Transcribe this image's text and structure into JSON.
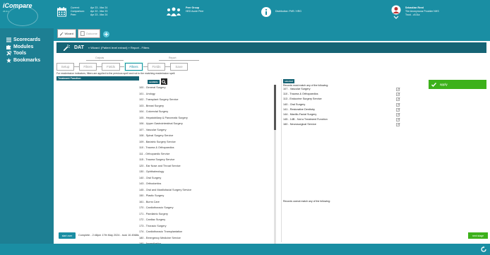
{
  "header": {
    "logo_text": "iCompare",
    "logo_version": "v5.0.1",
    "periods": [
      {
        "label": "Current:",
        "value": "Apr 23 - Mar 24"
      },
      {
        "label": "Comparison:",
        "value": "Apr 22 - Mar 23"
      },
      {
        "label": "Peer:",
        "value": "Apr 23 - Mar 24"
      }
    ],
    "peer_group": {
      "title": "Peer Group",
      "value": "HED Acute Peer"
    },
    "distribution": "Distribution: PbR / HRG",
    "user": {
      "name": "Sebastian Reed",
      "org": "The Anonymous Provider NHS",
      "trust": "Trust - z101a"
    }
  },
  "sidebar": {
    "items": [
      {
        "label": "Scorecards",
        "icon": "list-icon"
      },
      {
        "label": "Modules",
        "icon": "puzzle-icon"
      },
      {
        "label": "Tools",
        "icon": "tools-icon"
      },
      {
        "label": "Bookmarks",
        "icon": "star-icon"
      }
    ]
  },
  "toolbar": {
    "wizard_label": "Wizard",
    "outcome_label": "Outcome"
  },
  "title_bar": {
    "dat_label": "DAT",
    "breadcrumb": "»  Wizard: (Patient level extract)  »  Report - Filters"
  },
  "steps": {
    "groups": {
      "outputs": "Outputs",
      "report": "Report"
    },
    "items": [
      "Setup",
      "Filters",
      "Fields",
      "Filters",
      "Fields",
      "Save"
    ],
    "active_index": 3
  },
  "note": "For readmission indicators, filters are applied to the previous spell and not to the matching readmission spell.",
  "filter_field": "Treatment Function",
  "available": {
    "label": "available",
    "items": [
      "100 - General Surgery",
      "101 - Urology",
      "102 - Transplant Surgery Service",
      "103 - Breast Surgery",
      "104 - Colorectal Surgery",
      "105 - Hepatobiliary & Pancreatic Surgery",
      "106 - Upper Gastrointestinal Surgery",
      "107 - Vascular Surgery",
      "108 - Spinal Surgery Service",
      "109 - Bariatric Surgery Service",
      "110 - Trauma & Orthopaedics",
      "111 - Orthopaedic Service",
      "115 - Trauma Surgery Service",
      "120 - Ear Nose and Throat Service",
      "130 - Ophthalmology",
      "140 - Oral Surgery",
      "143 - Orthodontics",
      "145 - Oral and Maxillofacial Surgery Service",
      "150 - Plastic Surgery",
      "161 - Burns Care",
      "170 - Cardiothoracic Surgery",
      "171 - Paediatric Surgery",
      "172 - Cardiac Surgery",
      "173 - Thoracic Surgery",
      "174 - Cardiothoracic Transplantation",
      "180 - Emergency Medicine Service",
      "190 - Anaesthetics"
    ]
  },
  "selected": {
    "label": "selected",
    "must_match_text": "Records must match any of the following:",
    "cannot_match_text": "Records cannot match any of the following:",
    "items": [
      "107 - Vascular Surgery",
      "110 - Trauma & Orthopaedics",
      "113 - Endocrine Surgery Service",
      "140 - Oral Surgery",
      "141 - Restorative Dentistry",
      "144 - Maxillo-Facial Surgery",
      "145 - 14B - Not a Treatment Function",
      "160 - Neurosurgical Service"
    ]
  },
  "apply_label": "apply",
  "start_over_label": "start over",
  "complete_text": "Complete - 2:48pm 17th May 2024 - took 10.4568s",
  "next_stage_label": "next stage",
  "colors": {
    "brand_teal": "#1a8ea3",
    "dark_teal": "#166475",
    "apply_green": "#3db11b"
  }
}
